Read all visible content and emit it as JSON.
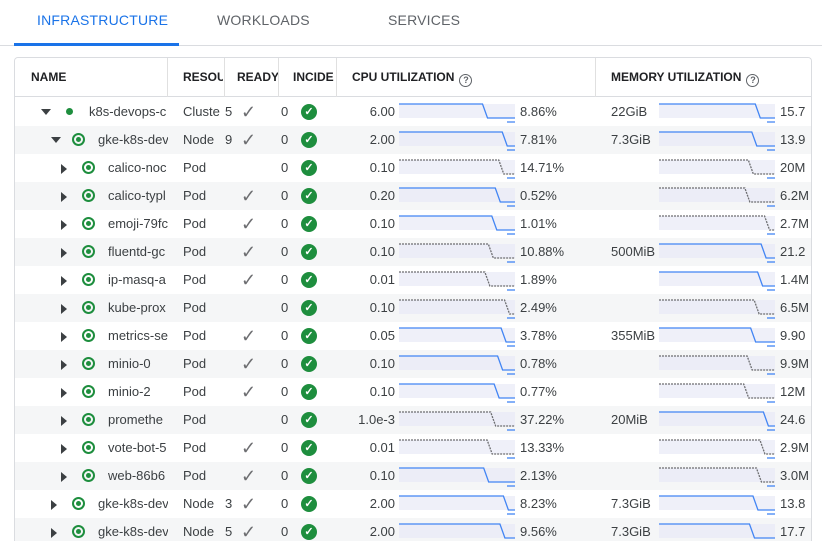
{
  "tabs": [
    {
      "label": "INFRASTRUCTURE",
      "active": true
    },
    {
      "label": "WORKLOADS",
      "active": false
    },
    {
      "label": "SERVICES",
      "active": false
    }
  ],
  "columns": {
    "name": "NAME",
    "resource": "RESOU",
    "ready": "READY",
    "incidents": "INCIDE",
    "cpu": "CPU UTILIZATION",
    "memory": "MEMORY UTILIZATION"
  },
  "colors": {
    "accent": "#1a73e8",
    "ok": "#1e8e3e",
    "spark_blue": "#4285f4",
    "spark_gray": "#6d6e71"
  },
  "rows": [
    {
      "level": 0,
      "expand": "down",
      "status": "dot",
      "name": "k8s-devops-c",
      "type": "Cluste",
      "count": "5",
      "ready": true,
      "incidents": "0",
      "cpu_limit": "6.00",
      "cpu_pct": "8.86%",
      "cpu_style": "blue",
      "mem_limit": "22GiB",
      "mem_val": "15.7",
      "mem_style": "blue"
    },
    {
      "level": 1,
      "expand": "down",
      "status": "ring",
      "name": "gke-k8s-dev",
      "type": "Node",
      "count": "9",
      "ready": true,
      "incidents": "0",
      "cpu_limit": "2.00",
      "cpu_pct": "7.81%",
      "cpu_style": "blue",
      "mem_limit": "7.3GiB",
      "mem_val": "13.9",
      "mem_style": "blue"
    },
    {
      "level": 2,
      "expand": "right",
      "status": "ring",
      "name": "calico-noc",
      "type": "Pod",
      "count": "",
      "ready": false,
      "incidents": "0",
      "cpu_limit": "0.10",
      "cpu_pct": "14.71%",
      "cpu_style": "gray",
      "mem_limit": "",
      "mem_val": "20M",
      "mem_style": "gray"
    },
    {
      "level": 2,
      "expand": "right",
      "status": "ring",
      "name": "calico-typl",
      "type": "Pod",
      "count": "",
      "ready": true,
      "incidents": "0",
      "cpu_limit": "0.20",
      "cpu_pct": "0.52%",
      "cpu_style": "blue",
      "mem_limit": "",
      "mem_val": "6.2M",
      "mem_style": "gray"
    },
    {
      "level": 2,
      "expand": "right",
      "status": "ring",
      "name": "emoji-79fc",
      "type": "Pod",
      "count": "",
      "ready": true,
      "incidents": "0",
      "cpu_limit": "0.10",
      "cpu_pct": "1.01%",
      "cpu_style": "blue",
      "mem_limit": "",
      "mem_val": "2.7M",
      "mem_style": "gray"
    },
    {
      "level": 2,
      "expand": "right",
      "status": "ring",
      "name": "fluentd-gc",
      "type": "Pod",
      "count": "",
      "ready": true,
      "incidents": "0",
      "cpu_limit": "0.10",
      "cpu_pct": "10.88%",
      "cpu_style": "gray",
      "mem_limit": "500MiB",
      "mem_val": "21.2",
      "mem_style": "blue"
    },
    {
      "level": 2,
      "expand": "right",
      "status": "ring",
      "name": "ip-masq-a",
      "type": "Pod",
      "count": "",
      "ready": true,
      "incidents": "0",
      "cpu_limit": "0.01",
      "cpu_pct": "1.89%",
      "cpu_style": "gray",
      "mem_limit": "",
      "mem_val": "1.4M",
      "mem_style": "blue"
    },
    {
      "level": 2,
      "expand": "right",
      "status": "ring",
      "name": "kube-prox",
      "type": "Pod",
      "count": "",
      "ready": false,
      "incidents": "0",
      "cpu_limit": "0.10",
      "cpu_pct": "2.49%",
      "cpu_style": "gray",
      "mem_limit": "",
      "mem_val": "6.5M",
      "mem_style": "gray"
    },
    {
      "level": 2,
      "expand": "right",
      "status": "ring",
      "name": "metrics-se",
      "type": "Pod",
      "count": "",
      "ready": true,
      "incidents": "0",
      "cpu_limit": "0.05",
      "cpu_pct": "3.78%",
      "cpu_style": "blue",
      "mem_limit": "355MiB",
      "mem_val": "9.90",
      "mem_style": "blue"
    },
    {
      "level": 2,
      "expand": "right",
      "status": "ring",
      "name": "minio-0",
      "type": "Pod",
      "count": "",
      "ready": true,
      "incidents": "0",
      "cpu_limit": "0.10",
      "cpu_pct": "0.78%",
      "cpu_style": "blue",
      "mem_limit": "",
      "mem_val": "9.9M",
      "mem_style": "gray"
    },
    {
      "level": 2,
      "expand": "right",
      "status": "ring",
      "name": "minio-2",
      "type": "Pod",
      "count": "",
      "ready": true,
      "incidents": "0",
      "cpu_limit": "0.10",
      "cpu_pct": "0.77%",
      "cpu_style": "blue",
      "mem_limit": "",
      "mem_val": "12M",
      "mem_style": "gray"
    },
    {
      "level": 2,
      "expand": "right",
      "status": "ring",
      "name": "promethe",
      "type": "Pod",
      "count": "",
      "ready": false,
      "incidents": "0",
      "cpu_limit": "1.0e-3",
      "cpu_pct": "37.22%",
      "cpu_style": "gray",
      "mem_limit": "20MiB",
      "mem_val": "24.6",
      "mem_style": "blue"
    },
    {
      "level": 2,
      "expand": "right",
      "status": "ring",
      "name": "vote-bot-5",
      "type": "Pod",
      "count": "",
      "ready": true,
      "incidents": "0",
      "cpu_limit": "0.01",
      "cpu_pct": "13.33%",
      "cpu_style": "gray",
      "mem_limit": "",
      "mem_val": "2.9M",
      "mem_style": "gray"
    },
    {
      "level": 2,
      "expand": "right",
      "status": "ring",
      "name": "web-86b6",
      "type": "Pod",
      "count": "",
      "ready": true,
      "incidents": "0",
      "cpu_limit": "0.10",
      "cpu_pct": "2.13%",
      "cpu_style": "blue",
      "mem_limit": "",
      "mem_val": "3.0M",
      "mem_style": "gray"
    },
    {
      "level": 1,
      "expand": "right",
      "status": "ring",
      "name": "gke-k8s-dev",
      "type": "Node",
      "count": "3",
      "ready": true,
      "incidents": "0",
      "cpu_limit": "2.00",
      "cpu_pct": "8.23%",
      "cpu_style": "blue",
      "mem_limit": "7.3GiB",
      "mem_val": "13.8",
      "mem_style": "blue"
    },
    {
      "level": 1,
      "expand": "right",
      "status": "ring",
      "name": "gke-k8s-dev",
      "type": "Node",
      "count": "5",
      "ready": true,
      "incidents": "0",
      "cpu_limit": "2.00",
      "cpu_pct": "9.56%",
      "cpu_style": "blue",
      "mem_limit": "7.3GiB",
      "mem_val": "17.7",
      "mem_style": "blue"
    }
  ]
}
